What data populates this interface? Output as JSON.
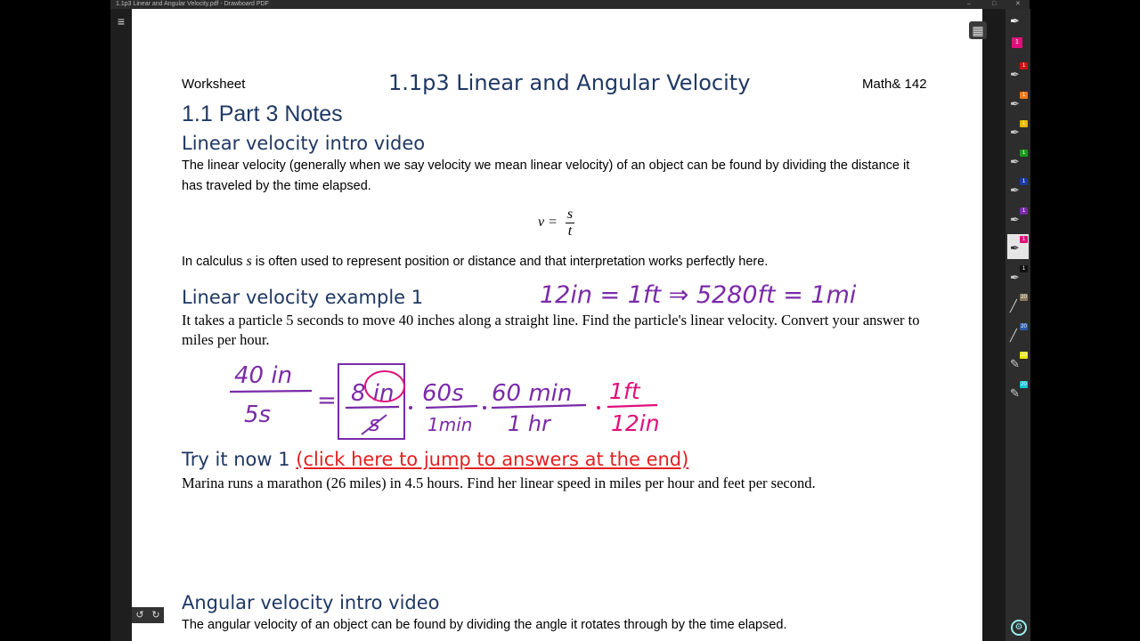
{
  "window": {
    "title": "1.1p3 Linear and Angular Velocity.pdf - Drawboard PDF"
  },
  "header": {
    "left": "Worksheet",
    "center": "1.1p3 Linear and Angular Velocity",
    "right": "Math& 142"
  },
  "section": {
    "title": "1.1 Part 3 Notes"
  },
  "linear_intro": {
    "heading": "Linear velocity intro video",
    "text": "The linear velocity (generally when we say velocity we mean linear velocity) of an object can be found by dividing the distance it has traveled by the time elapsed.",
    "formula": {
      "lhs": "v =",
      "num": "s",
      "den": "t"
    },
    "calc_pre": "In calculus ",
    "calc_var": "s",
    "calc_post": " is often used to represent position or distance  and that interpretation works perfectly here."
  },
  "example1": {
    "heading": "Linear velocity example 1",
    "text": "It takes a particle 5 seconds to move 40 inches along a straight line.  Find the particle's linear velocity.  Convert your answer to miles per hour."
  },
  "ink": {
    "line1": "12in = 1ft  ⇒  5280ft = 1mi",
    "work": {
      "a_num": "40 in",
      "a_den": "5s",
      "eq": "=",
      "b_num": "8 in",
      "b_den": "s",
      "c_num": "60s",
      "c_den": "1min",
      "d_num": "60 min",
      "d_den": "1 hr",
      "e_num": "1ft",
      "e_den": "12in"
    }
  },
  "try1": {
    "heading": "Try it now 1 ",
    "link": "(click here to jump to answers at the end)",
    "text": "Marina runs a marathon (26 miles) in 4.5 hours.  Find her linear speed in miles per hour and feet per second."
  },
  "angular_intro": {
    "heading": "Angular velocity intro video",
    "text": "The angular velocity of an object can be found by dividing the angle it rotates through by the time elapsed."
  },
  "toolbar": {
    "tools": [
      {
        "name": "pen-tool-pink",
        "badge": "1",
        "color": "#e0107a",
        "icon": "pen-icon"
      },
      {
        "name": "pen-tool-red",
        "badge": "1",
        "color": "#d01010",
        "icon": "pen-icon"
      },
      {
        "name": "pen-tool-orange",
        "badge": "1",
        "color": "#f07a1a",
        "icon": "pen-icon"
      },
      {
        "name": "pen-tool-yellow",
        "badge": "1",
        "color": "#e8b800",
        "icon": "pen-icon"
      },
      {
        "name": "pen-tool-green",
        "badge": "1",
        "color": "#1a9a1a",
        "icon": "pen-icon"
      },
      {
        "name": "pen-tool-blue",
        "badge": "1",
        "color": "#1a3aa8",
        "icon": "pen-icon"
      },
      {
        "name": "pen-tool-purple",
        "badge": "1",
        "color": "#7a2aa8",
        "icon": "pen-icon"
      },
      {
        "name": "pen-tool-magenta",
        "badge": "1",
        "color": "#e0107a",
        "icon": "pen-icon"
      },
      {
        "name": "pen-tool-black",
        "badge": "1",
        "color": "#111111",
        "icon": "pen-icon"
      },
      {
        "name": "dashed-pen-tool-tan",
        "badge": "20",
        "color": "#8a7a5a",
        "icon": "dashed-pen-icon"
      },
      {
        "name": "dashed-pen-tool-blue",
        "badge": "20",
        "color": "#2a5aa8",
        "icon": "dashed-pen-icon"
      },
      {
        "name": "highlighter-tool-yellow",
        "badge": "20",
        "color": "#e8e800",
        "icon": "highlighter-icon"
      },
      {
        "name": "highlighter-tool-cyan",
        "badge": "20",
        "color": "#10c8d8",
        "icon": "highlighter-icon"
      }
    ]
  }
}
